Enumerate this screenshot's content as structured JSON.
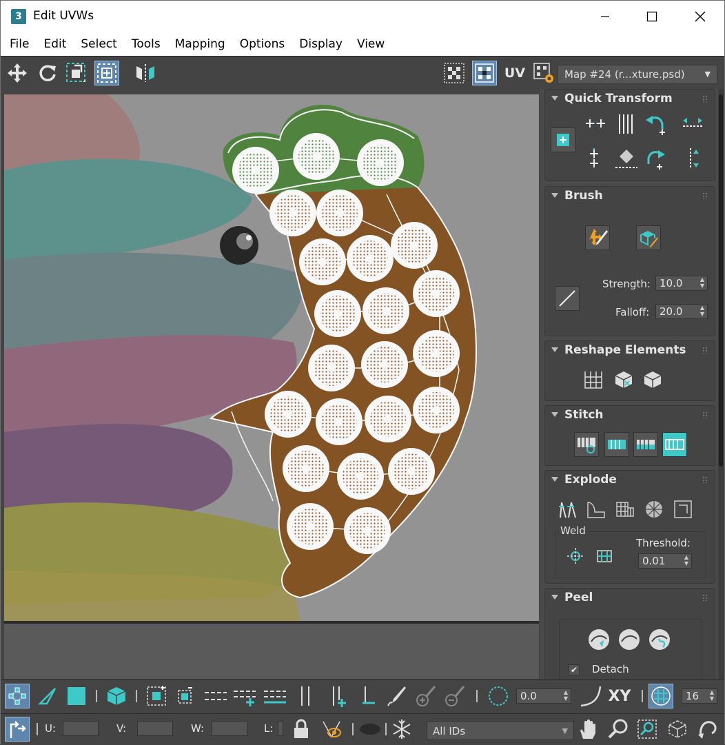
{
  "window": {
    "title": "Edit UVWs",
    "app_icon_text": "3"
  },
  "menubar": [
    "File",
    "Edit",
    "Select",
    "Tools",
    "Mapping",
    "Options",
    "Display",
    "View"
  ],
  "toolbar": {
    "uv_label": "UV",
    "map_selector": "Map #24 (r...xture.psd)"
  },
  "panel": {
    "quick_transform": {
      "title": "Quick Transform"
    },
    "brush": {
      "title": "Brush",
      "strength_label": "Strength:",
      "strength_value": "10.0",
      "falloff_label": "Falloff:",
      "falloff_value": "20.0"
    },
    "reshape": {
      "title": "Reshape Elements"
    },
    "stitch": {
      "title": "Stitch"
    },
    "explode": {
      "title": "Explode",
      "weld_label": "Weld",
      "threshold_label": "Threshold:",
      "threshold_value": "0.01"
    },
    "peel": {
      "title": "Peel",
      "detach_label": "Detach",
      "detach_checked": true
    }
  },
  "bottom": {
    "rotation_value": "0.0",
    "xy_label": "XY",
    "grid_value": "16",
    "u_label": "U:",
    "v_label": "V:",
    "w_label": "W:",
    "l_label": "L:",
    "ids_value": "All IDs"
  },
  "colors": {
    "accent": "#3ec9c9",
    "selection_blue": "#5f86ad",
    "uv_brown": "#7a440e",
    "uv_green": "#3f7a2c"
  }
}
